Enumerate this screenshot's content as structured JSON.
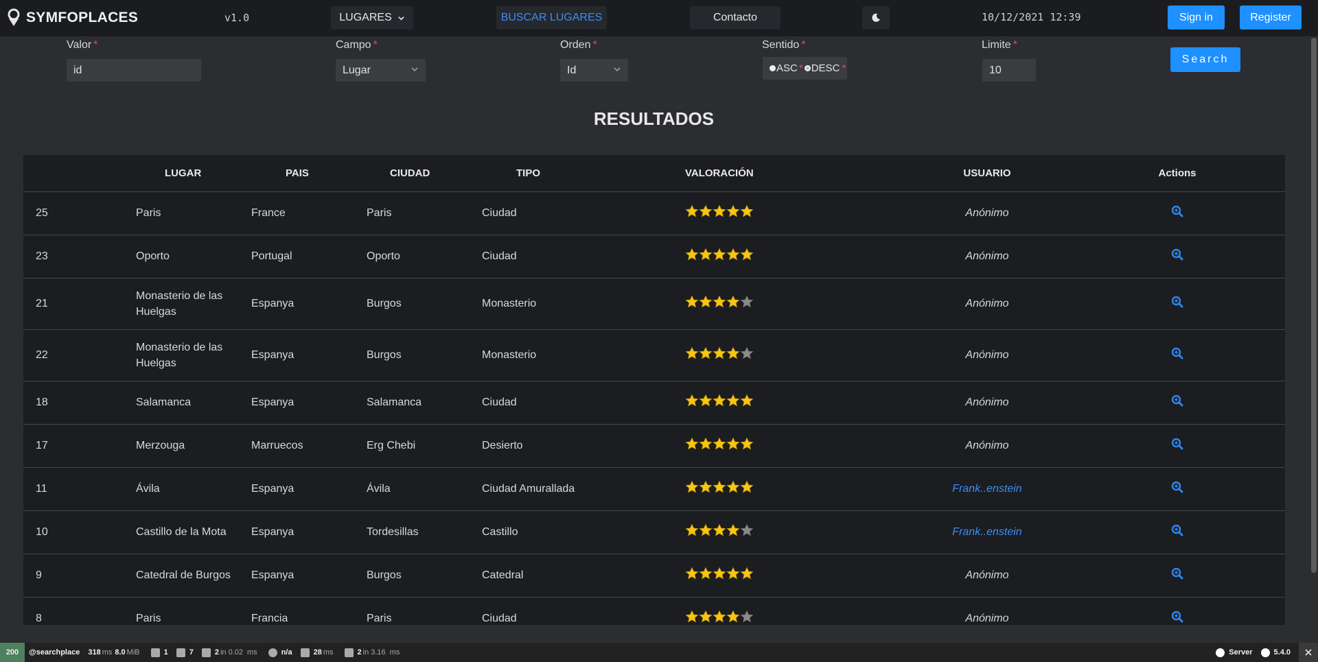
{
  "navbar": {
    "brand": "SYMFOPLACES",
    "version": "v1.0",
    "menu_lugares": "LUGARES",
    "menu_buscar": "BUSCAR LUGARES",
    "menu_contacto": "Contacto",
    "theme_icon": "moon-icon",
    "datetime": "10/12/2021 12:39",
    "signin": "Sign in",
    "register": "Register"
  },
  "form": {
    "valor_label": "Valor",
    "valor_value": "id",
    "campo_label": "Campo",
    "campo_value": "Lugar",
    "orden_label": "Orden",
    "orden_value": "Id",
    "sentido_label": "Sentido",
    "asc_label": "ASC",
    "desc_label": "DESC",
    "sentido_selected": "ASC",
    "limite_label": "Limite",
    "limite_value": "10",
    "required_mark": "*",
    "search_button": "Search"
  },
  "results": {
    "title": "RESULTADOS",
    "headers": [
      "",
      "LUGAR",
      "PAIS",
      "CIUDAD",
      "TIPO",
      "VALORACIÓN",
      "USUARIO",
      "Actions"
    ],
    "rows": [
      {
        "id": "25",
        "lugar": "Paris",
        "pais": "France",
        "ciudad": "Paris",
        "tipo": "Ciudad",
        "rating": 5,
        "usuario": "Anónimo"
      },
      {
        "id": "23",
        "lugar": "Oporto",
        "pais": "Portugal",
        "ciudad": "Oporto",
        "tipo": "Ciudad",
        "rating": 5,
        "usuario": "Anónimo"
      },
      {
        "id": "21",
        "lugar": "Monasterio de las Huelgas",
        "pais": "Espanya",
        "ciudad": "Burgos",
        "tipo": "Monasterio",
        "rating": 4,
        "usuario": "Anónimo"
      },
      {
        "id": "22",
        "lugar": "Monasterio de las Huelgas",
        "pais": "Espanya",
        "ciudad": "Burgos",
        "tipo": "Monasterio",
        "rating": 4,
        "usuario": "Anónimo"
      },
      {
        "id": "18",
        "lugar": "Salamanca",
        "pais": "Espanya",
        "ciudad": "Salamanca",
        "tipo": "Ciudad",
        "rating": 5,
        "usuario": "Anónimo"
      },
      {
        "id": "17",
        "lugar": "Merzouga",
        "pais": "Marruecos",
        "ciudad": "Erg Chebi",
        "tipo": "Desierto",
        "rating": 5,
        "usuario": "Anónimo"
      },
      {
        "id": "11",
        "lugar": "Ávila",
        "pais": "Espanya",
        "ciudad": "Ávila",
        "tipo": "Ciudad Amurallada",
        "rating": 5,
        "usuario": "Frank..enstein"
      },
      {
        "id": "10",
        "lugar": "Castillo de la Mota",
        "pais": "Espanya",
        "ciudad": "Tordesillas",
        "tipo": "Castillo",
        "rating": 4,
        "usuario": "Frank..enstein"
      },
      {
        "id": "9",
        "lugar": "Catedral de Burgos",
        "pais": "Espanya",
        "ciudad": "Burgos",
        "tipo": "Catedral",
        "rating": 5,
        "usuario": "Anónimo"
      },
      {
        "id": "8",
        "lugar": "Paris",
        "pais": "Francia",
        "ciudad": "Paris",
        "tipo": "Ciudad",
        "rating": 4,
        "usuario": "Anónimo"
      }
    ],
    "action_icon": "zoom-search-icon"
  },
  "toolbar": {
    "status": "200",
    "route": "@searchplace",
    "time": "318",
    "time_unit": "ms",
    "memory": "8.0",
    "memory_unit": "MiB",
    "forms": "1",
    "logs": "7",
    "cache": "2",
    "cache_in": "in 0.02",
    "cache_unit": "ms",
    "user": "n/a",
    "twig": "28",
    "twig_unit": "ms",
    "db": "2",
    "db_in": "in 3.16",
    "db_unit": "ms",
    "server": "Server",
    "sf_version": "5.4.0"
  },
  "colors": {
    "accent": "#1e90ff",
    "link": "#3d8df5",
    "star": "#f5c518",
    "star_empty": "#8a8a8a",
    "status_ok": "#4f805d"
  }
}
